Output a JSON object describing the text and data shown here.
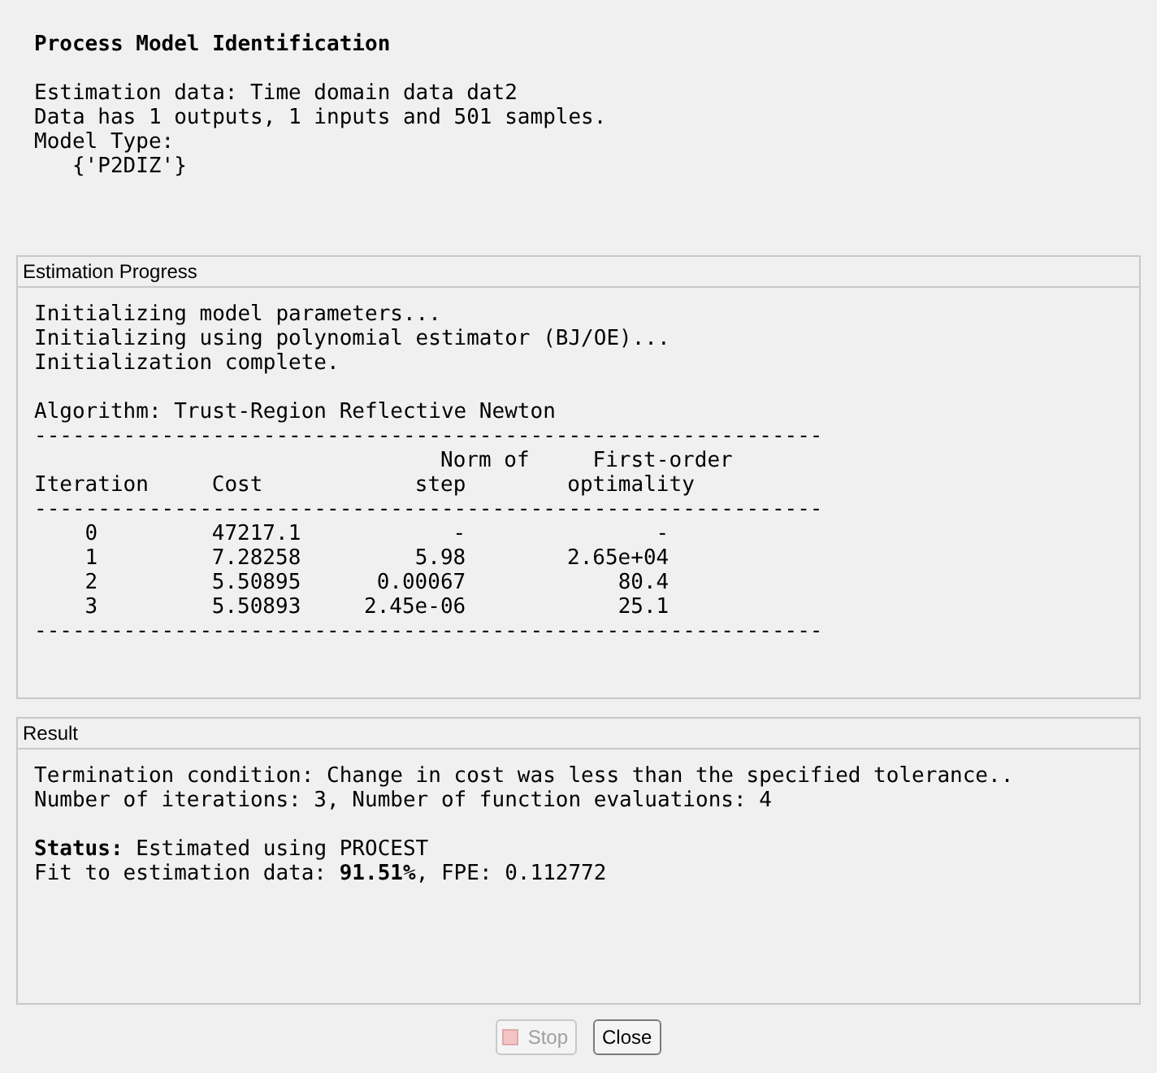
{
  "title": "Process Model Identification",
  "info_lines": [
    {
      "kind": "blank"
    },
    {
      "kind": "plain",
      "text": "Estimation data: Time domain data dat2"
    },
    {
      "kind": "plain",
      "text": "Data has 1 outputs, 1 inputs and 501 samples."
    },
    {
      "kind": "plain",
      "text": "Model Type:"
    },
    {
      "kind": "indented",
      "text": "{'P2DIZ'}"
    }
  ],
  "progress": {
    "title": "Estimation Progress",
    "lines": [
      {
        "kind": "plain",
        "text": "Initializing model parameters..."
      },
      {
        "kind": "plain",
        "text": "Initializing using polynomial estimator (BJ/OE)..."
      },
      {
        "kind": "plain",
        "text": "Initialization complete."
      },
      {
        "kind": "blank"
      },
      {
        "kind": "plain",
        "text": "Algorithm: Trust-Region Reflective Newton"
      }
    ],
    "table": {
      "top_rule": "--------------------------------------------------------------",
      "columns": [
        {
          "lines": [
            "Iteration"
          ]
        },
        {
          "lines": [
            "Cost"
          ]
        },
        {
          "lines": [
            "Norm of",
            "step"
          ]
        },
        {
          "lines": [
            "First-order",
            "optimality"
          ]
        }
      ],
      "header_rule": "--------------------------------------------------------------",
      "rows": [
        [
          "0",
          "47217.1",
          "-",
          "-"
        ],
        [
          "1",
          "7.28258",
          "5.98",
          "2.65e+04"
        ],
        [
          "2",
          "5.50895",
          "0.00067",
          "80.4"
        ],
        [
          "3",
          "5.50893",
          "2.45e-06",
          "25.1"
        ]
      ],
      "bottom_rule": "--------------------------------------------------------------"
    }
  },
  "result": {
    "title": "Result",
    "lines": [
      {
        "kind": "plain",
        "text": "Termination condition: Change in cost was less than the specified tolerance.."
      },
      {
        "kind": "plain",
        "text": "Number of iterations: 3, Number of function evaluations: 4"
      },
      {
        "kind": "blank"
      },
      {
        "kind": "plain",
        "text": "**Status:** Estimated using PROCEST"
      },
      {
        "kind": "plain",
        "text": "Fit to estimation data: **91.51%**, FPE: 0.112772"
      }
    ]
  },
  "buttons": [
    {
      "kind": "stop",
      "label": "Stop",
      "disabled": true
    },
    {
      "kind": "close",
      "label": "Close",
      "disabled": false
    }
  ]
}
